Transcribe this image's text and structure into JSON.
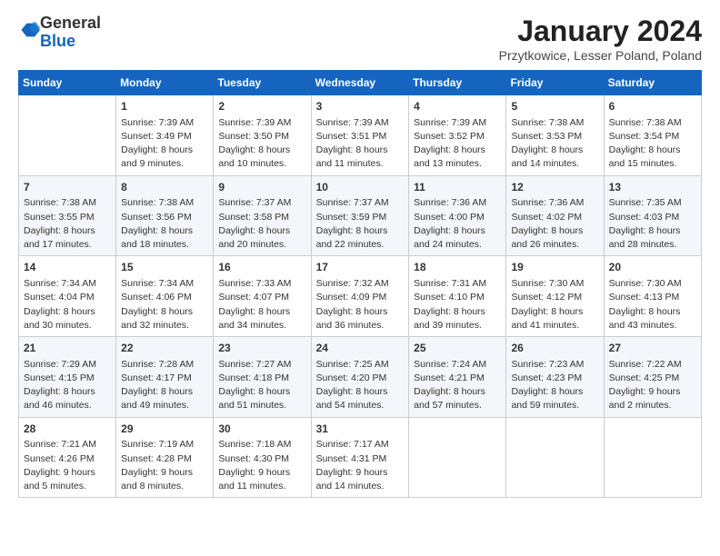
{
  "header": {
    "logo_general": "General",
    "logo_blue": "Blue",
    "month_title": "January 2024",
    "location": "Przytkowice, Lesser Poland, Poland"
  },
  "weekdays": [
    "Sunday",
    "Monday",
    "Tuesday",
    "Wednesday",
    "Thursday",
    "Friday",
    "Saturday"
  ],
  "weeks": [
    [
      {
        "day": "",
        "sunrise": "",
        "sunset": "",
        "daylight": ""
      },
      {
        "day": "1",
        "sunrise": "Sunrise: 7:39 AM",
        "sunset": "Sunset: 3:49 PM",
        "daylight": "Daylight: 8 hours and 9 minutes."
      },
      {
        "day": "2",
        "sunrise": "Sunrise: 7:39 AM",
        "sunset": "Sunset: 3:50 PM",
        "daylight": "Daylight: 8 hours and 10 minutes."
      },
      {
        "day": "3",
        "sunrise": "Sunrise: 7:39 AM",
        "sunset": "Sunset: 3:51 PM",
        "daylight": "Daylight: 8 hours and 11 minutes."
      },
      {
        "day": "4",
        "sunrise": "Sunrise: 7:39 AM",
        "sunset": "Sunset: 3:52 PM",
        "daylight": "Daylight: 8 hours and 13 minutes."
      },
      {
        "day": "5",
        "sunrise": "Sunrise: 7:38 AM",
        "sunset": "Sunset: 3:53 PM",
        "daylight": "Daylight: 8 hours and 14 minutes."
      },
      {
        "day": "6",
        "sunrise": "Sunrise: 7:38 AM",
        "sunset": "Sunset: 3:54 PM",
        "daylight": "Daylight: 8 hours and 15 minutes."
      }
    ],
    [
      {
        "day": "7",
        "sunrise": "Sunrise: 7:38 AM",
        "sunset": "Sunset: 3:55 PM",
        "daylight": "Daylight: 8 hours and 17 minutes."
      },
      {
        "day": "8",
        "sunrise": "Sunrise: 7:38 AM",
        "sunset": "Sunset: 3:56 PM",
        "daylight": "Daylight: 8 hours and 18 minutes."
      },
      {
        "day": "9",
        "sunrise": "Sunrise: 7:37 AM",
        "sunset": "Sunset: 3:58 PM",
        "daylight": "Daylight: 8 hours and 20 minutes."
      },
      {
        "day": "10",
        "sunrise": "Sunrise: 7:37 AM",
        "sunset": "Sunset: 3:59 PM",
        "daylight": "Daylight: 8 hours and 22 minutes."
      },
      {
        "day": "11",
        "sunrise": "Sunrise: 7:36 AM",
        "sunset": "Sunset: 4:00 PM",
        "daylight": "Daylight: 8 hours and 24 minutes."
      },
      {
        "day": "12",
        "sunrise": "Sunrise: 7:36 AM",
        "sunset": "Sunset: 4:02 PM",
        "daylight": "Daylight: 8 hours and 26 minutes."
      },
      {
        "day": "13",
        "sunrise": "Sunrise: 7:35 AM",
        "sunset": "Sunset: 4:03 PM",
        "daylight": "Daylight: 8 hours and 28 minutes."
      }
    ],
    [
      {
        "day": "14",
        "sunrise": "Sunrise: 7:34 AM",
        "sunset": "Sunset: 4:04 PM",
        "daylight": "Daylight: 8 hours and 30 minutes."
      },
      {
        "day": "15",
        "sunrise": "Sunrise: 7:34 AM",
        "sunset": "Sunset: 4:06 PM",
        "daylight": "Daylight: 8 hours and 32 minutes."
      },
      {
        "day": "16",
        "sunrise": "Sunrise: 7:33 AM",
        "sunset": "Sunset: 4:07 PM",
        "daylight": "Daylight: 8 hours and 34 minutes."
      },
      {
        "day": "17",
        "sunrise": "Sunrise: 7:32 AM",
        "sunset": "Sunset: 4:09 PM",
        "daylight": "Daylight: 8 hours and 36 minutes."
      },
      {
        "day": "18",
        "sunrise": "Sunrise: 7:31 AM",
        "sunset": "Sunset: 4:10 PM",
        "daylight": "Daylight: 8 hours and 39 minutes."
      },
      {
        "day": "19",
        "sunrise": "Sunrise: 7:30 AM",
        "sunset": "Sunset: 4:12 PM",
        "daylight": "Daylight: 8 hours and 41 minutes."
      },
      {
        "day": "20",
        "sunrise": "Sunrise: 7:30 AM",
        "sunset": "Sunset: 4:13 PM",
        "daylight": "Daylight: 8 hours and 43 minutes."
      }
    ],
    [
      {
        "day": "21",
        "sunrise": "Sunrise: 7:29 AM",
        "sunset": "Sunset: 4:15 PM",
        "daylight": "Daylight: 8 hours and 46 minutes."
      },
      {
        "day": "22",
        "sunrise": "Sunrise: 7:28 AM",
        "sunset": "Sunset: 4:17 PM",
        "daylight": "Daylight: 8 hours and 49 minutes."
      },
      {
        "day": "23",
        "sunrise": "Sunrise: 7:27 AM",
        "sunset": "Sunset: 4:18 PM",
        "daylight": "Daylight: 8 hours and 51 minutes."
      },
      {
        "day": "24",
        "sunrise": "Sunrise: 7:25 AM",
        "sunset": "Sunset: 4:20 PM",
        "daylight": "Daylight: 8 hours and 54 minutes."
      },
      {
        "day": "25",
        "sunrise": "Sunrise: 7:24 AM",
        "sunset": "Sunset: 4:21 PM",
        "daylight": "Daylight: 8 hours and 57 minutes."
      },
      {
        "day": "26",
        "sunrise": "Sunrise: 7:23 AM",
        "sunset": "Sunset: 4:23 PM",
        "daylight": "Daylight: 8 hours and 59 minutes."
      },
      {
        "day": "27",
        "sunrise": "Sunrise: 7:22 AM",
        "sunset": "Sunset: 4:25 PM",
        "daylight": "Daylight: 9 hours and 2 minutes."
      }
    ],
    [
      {
        "day": "28",
        "sunrise": "Sunrise: 7:21 AM",
        "sunset": "Sunset: 4:26 PM",
        "daylight": "Daylight: 9 hours and 5 minutes."
      },
      {
        "day": "29",
        "sunrise": "Sunrise: 7:19 AM",
        "sunset": "Sunset: 4:28 PM",
        "daylight": "Daylight: 9 hours and 8 minutes."
      },
      {
        "day": "30",
        "sunrise": "Sunrise: 7:18 AM",
        "sunset": "Sunset: 4:30 PM",
        "daylight": "Daylight: 9 hours and 11 minutes."
      },
      {
        "day": "31",
        "sunrise": "Sunrise: 7:17 AM",
        "sunset": "Sunset: 4:31 PM",
        "daylight": "Daylight: 9 hours and 14 minutes."
      },
      {
        "day": "",
        "sunrise": "",
        "sunset": "",
        "daylight": ""
      },
      {
        "day": "",
        "sunrise": "",
        "sunset": "",
        "daylight": ""
      },
      {
        "day": "",
        "sunrise": "",
        "sunset": "",
        "daylight": ""
      }
    ]
  ]
}
